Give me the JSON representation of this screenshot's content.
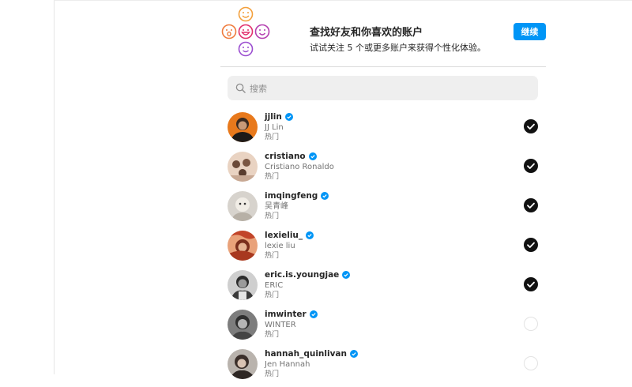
{
  "header": {
    "title": "查找好友和你喜欢的账户",
    "subtitle": "试试关注 5 个或更多账户来获得个性化体验。",
    "continue_label": "继续"
  },
  "search": {
    "placeholder": "搜索"
  },
  "users": [
    {
      "handle": "jjlin",
      "name": "JJ Lin",
      "tag": "热门",
      "verified": true,
      "selected": true
    },
    {
      "handle": "cristiano",
      "name": "Cristiano Ronaldo",
      "tag": "热门",
      "verified": true,
      "selected": true
    },
    {
      "handle": "imqingfeng",
      "name": "吴青峰",
      "tag": "热门",
      "verified": true,
      "selected": true
    },
    {
      "handle": "lexieliu_",
      "name": "lexie liu",
      "tag": "热门",
      "verified": true,
      "selected": true
    },
    {
      "handle": "eric.is.youngjae",
      "name": "ERIC",
      "tag": "热门",
      "verified": true,
      "selected": true
    },
    {
      "handle": "imwinter",
      "name": "WINTER",
      "tag": "热门",
      "verified": true,
      "selected": false
    },
    {
      "handle": "hannah_quinlivan",
      "name": "Jen Hannah",
      "tag": "热门",
      "verified": true,
      "selected": false
    }
  ],
  "colors": {
    "accent": "#0095f6",
    "verified": "#0095f6",
    "faces": "#c13584"
  },
  "icons": {
    "search": "search-icon",
    "verified": "verified-badge-icon",
    "check": "check-icon",
    "faces": "emoji-faces-icon"
  }
}
